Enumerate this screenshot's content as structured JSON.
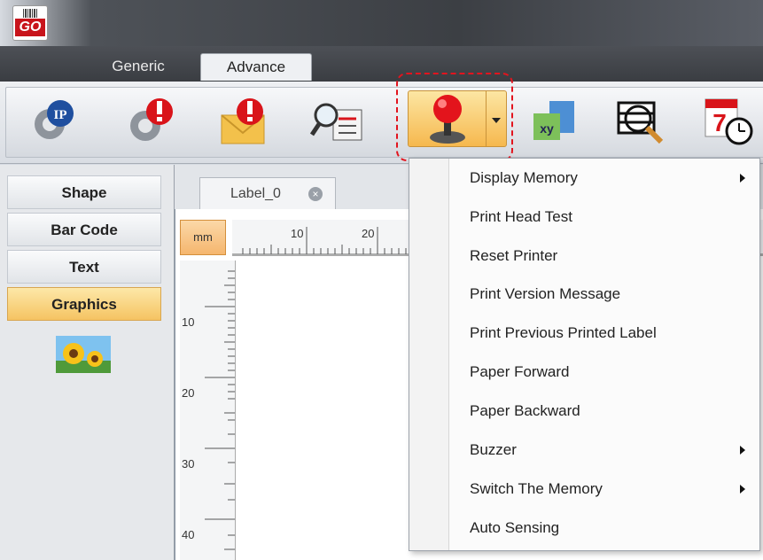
{
  "app": {
    "logo_text": "GO"
  },
  "ribbon": {
    "tabs": [
      {
        "label": "Generic"
      },
      {
        "label": "Advance",
        "active": true
      }
    ]
  },
  "toolbar": {
    "buttons": [
      {
        "icon": "ip-settings-icon"
      },
      {
        "icon": "printer-alert-settings-icon"
      },
      {
        "icon": "email-alert-icon"
      },
      {
        "icon": "search-setup-icon"
      },
      {
        "icon": "printer-control-joystick-icon",
        "has_dropdown": true,
        "active": true
      },
      {
        "icon": "variable-data-icon"
      },
      {
        "icon": "zoom-preview-icon"
      },
      {
        "icon": "date-time-icon",
        "calendar_day": "7"
      }
    ]
  },
  "left_panel": {
    "items": [
      "Shape",
      "Bar Code",
      "Text",
      "Graphics"
    ],
    "active_index": 3,
    "graphics_thumb": "sunflower-image"
  },
  "document": {
    "tab_label": "Label_0",
    "unit": "mm",
    "h_ruler_labels": [
      "10",
      "20"
    ],
    "v_ruler_labels": [
      "10",
      "20",
      "30",
      "40"
    ]
  },
  "dropdown_menu": {
    "items": [
      {
        "label": "Display Memory",
        "submenu": true
      },
      {
        "label": "Print Head Test",
        "submenu": false
      },
      {
        "label": "Reset Printer",
        "submenu": false
      },
      {
        "label": "Print Version Message",
        "submenu": false
      },
      {
        "label": "Print Previous Printed Label",
        "submenu": false
      },
      {
        "label": "Paper Forward",
        "submenu": false
      },
      {
        "label": "Paper Backward",
        "submenu": false
      },
      {
        "label": "Buzzer",
        "submenu": true
      },
      {
        "label": "Switch The Memory",
        "submenu": true
      },
      {
        "label": "Auto Sensing",
        "submenu": false
      }
    ]
  },
  "colors": {
    "accent_orange": "#f5b55c",
    "highlight_red": "#e2141e"
  }
}
